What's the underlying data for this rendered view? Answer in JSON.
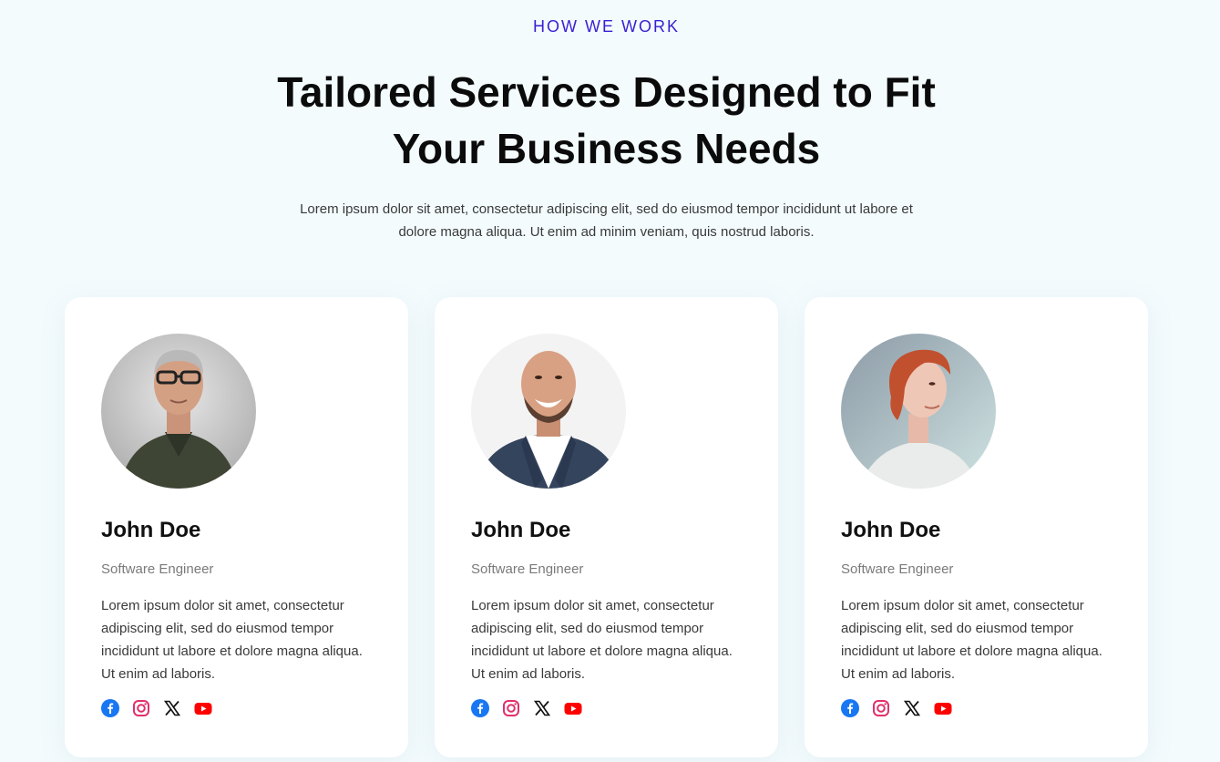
{
  "section": {
    "eyebrow": "HOW WE WORK",
    "heading_line1": "Tailored Services Designed to Fit",
    "heading_line2": "Your Business Needs",
    "intro_line1": "Lorem ipsum dolor sit amet, consectetur adipiscing elit, sed do eiusmod tempor incididunt ut labore et",
    "intro_line2": "dolore magna aliqua. Ut enim ad minim veniam, quis nostrud laboris."
  },
  "colors": {
    "accent": "#3a1fd1",
    "facebook": "#1877f2",
    "instagram": "#e1306c",
    "x": "#111111",
    "youtube": "#ff0000"
  },
  "cards": [
    {
      "name": "John Doe",
      "role": "Software Engineer",
      "bio": "Lorem ipsum dolor sit amet, consectetur adipiscing elit, sed do eiusmod tempor incididunt ut labore et dolore magna aliqua. Ut enim ad laboris.",
      "socials": [
        "facebook-icon",
        "instagram-icon",
        "x-icon",
        "youtube-icon"
      ]
    },
    {
      "name": "John Doe",
      "role": "Software Engineer",
      "bio": "Lorem ipsum dolor sit amet, consectetur adipiscing elit, sed do eiusmod tempor incididunt ut labore et dolore magna aliqua. Ut enim ad laboris.",
      "socials": [
        "facebook-icon",
        "instagram-icon",
        "x-icon",
        "youtube-icon"
      ]
    },
    {
      "name": "John Doe",
      "role": "Software Engineer",
      "bio": "Lorem ipsum dolor sit amet, consectetur adipiscing elit, sed do eiusmod tempor incididunt ut labore et dolore magna aliqua. Ut enim ad laboris.",
      "socials": [
        "facebook-icon",
        "instagram-icon",
        "x-icon",
        "youtube-icon"
      ]
    }
  ]
}
